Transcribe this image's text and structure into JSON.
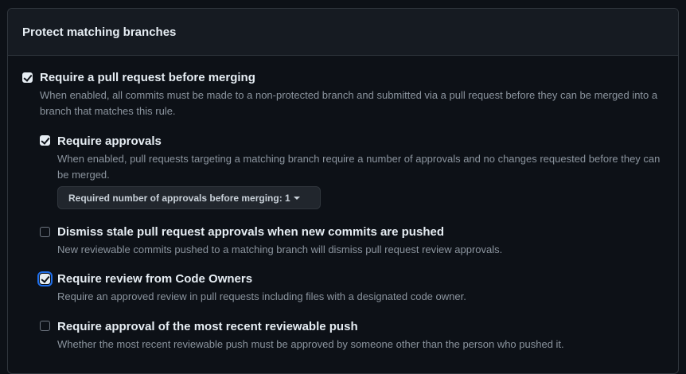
{
  "section": {
    "title": "Protect matching branches"
  },
  "rules": [
    {
      "title": "Require a pull request before merging",
      "description": "When enabled, all commits must be made to a non-protected branch and submitted via a pull request before they can be merged into a branch that matches this rule.",
      "checked": true
    },
    {
      "title": "Require approvals",
      "description": "When enabled, pull requests targeting a matching branch require a number of approvals and no changes requested before they can be merged.",
      "checked": true,
      "dropdown_label": "Required number of approvals before merging: 1"
    },
    {
      "title": "Dismiss stale pull request approvals when new commits are pushed",
      "description": "New reviewable commits pushed to a matching branch will dismiss pull request review approvals.",
      "checked": false
    },
    {
      "title": "Require review from Code Owners",
      "description": "Require an approved review in pull requests including files with a designated code owner.",
      "checked": true
    },
    {
      "title": "Require approval of the most recent reviewable push",
      "description": "Whether the most recent reviewable push must be approved by someone other than the person who pushed it.",
      "checked": false
    }
  ],
  "colors": {
    "background": "#0d1117",
    "header_background": "#161b22",
    "border": "#30363d",
    "muted_text": "#8b949e",
    "focus_ring": "#1f6feb"
  }
}
